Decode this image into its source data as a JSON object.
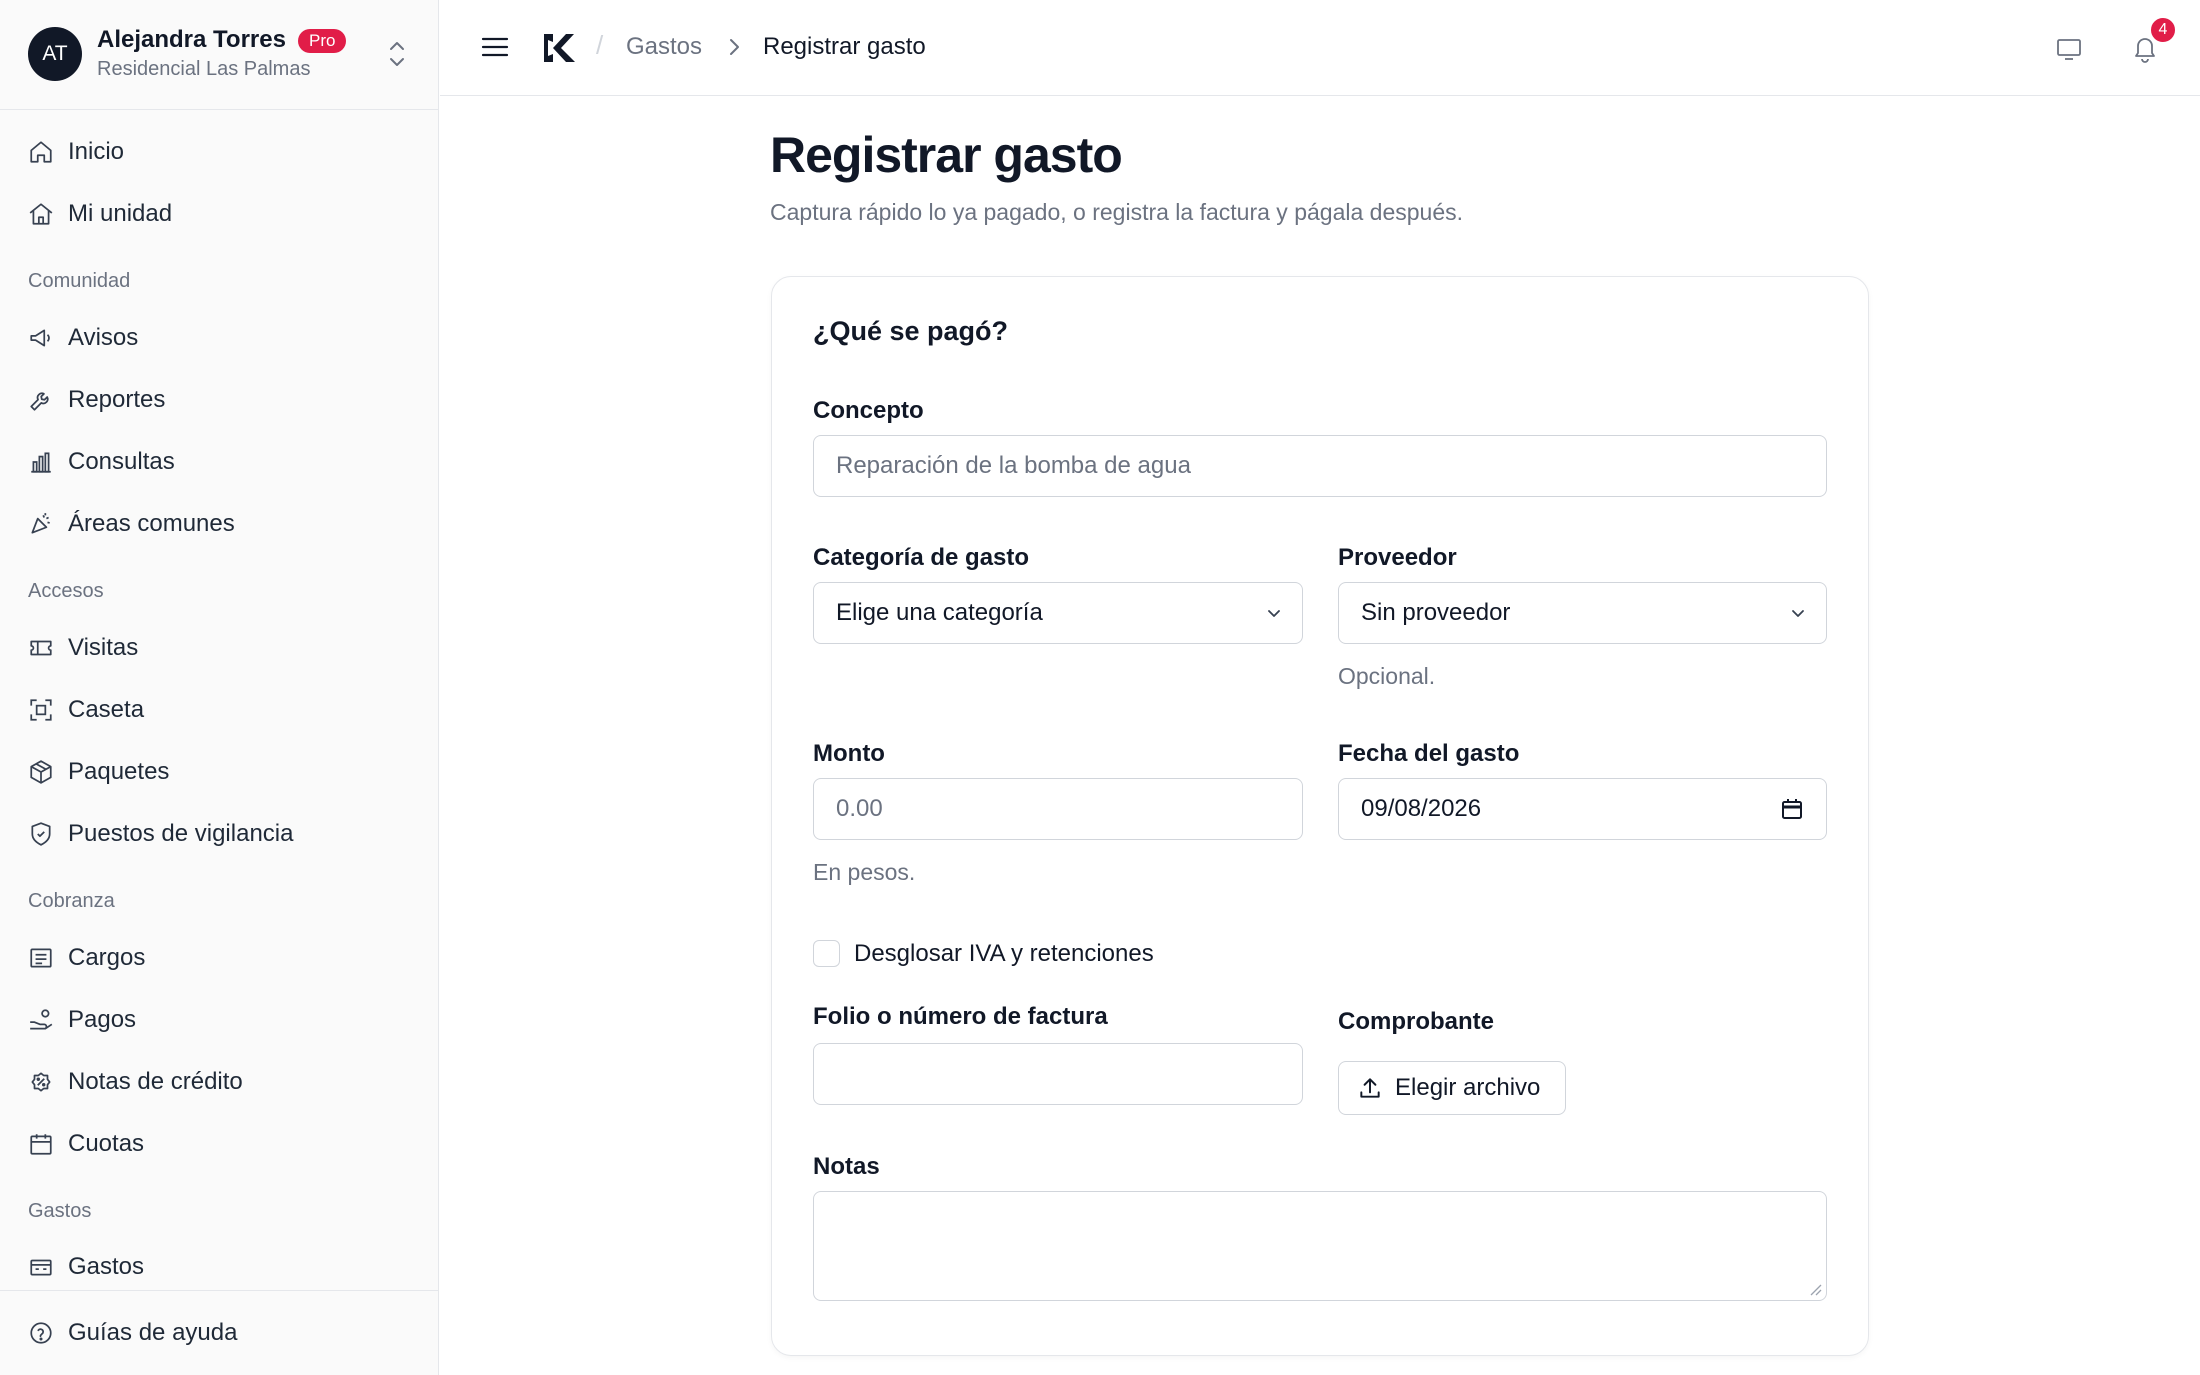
{
  "account": {
    "initials": "AT",
    "name": "Alejandra Torres",
    "plan_badge": "Pro",
    "community": "Residencial Las Palmas"
  },
  "sidebar": {
    "top_items": [
      {
        "label": "Inicio",
        "icon": "home-icon"
      },
      {
        "label": "Mi unidad",
        "icon": "house-icon"
      }
    ],
    "sections": [
      {
        "title": "Comunidad",
        "items": [
          {
            "label": "Avisos",
            "icon": "megaphone-icon"
          },
          {
            "label": "Reportes",
            "icon": "wrench-icon"
          },
          {
            "label": "Consultas",
            "icon": "bar-chart-icon"
          },
          {
            "label": "Áreas comunes",
            "icon": "party-popper-icon"
          }
        ]
      },
      {
        "title": "Accesos",
        "items": [
          {
            "label": "Visitas",
            "icon": "ticket-icon"
          },
          {
            "label": "Caseta",
            "icon": "scan-icon"
          },
          {
            "label": "Paquetes",
            "icon": "package-icon"
          },
          {
            "label": "Puestos de vigilancia",
            "icon": "shield-icon"
          }
        ]
      },
      {
        "title": "Cobranza",
        "items": [
          {
            "label": "Cargos",
            "icon": "receipt-icon"
          },
          {
            "label": "Pagos",
            "icon": "hand-coins-icon"
          },
          {
            "label": "Notas de crédito",
            "icon": "badge-percent-icon"
          },
          {
            "label": "Cuotas",
            "icon": "calendar-icon"
          }
        ]
      },
      {
        "title": "Gastos",
        "items": [
          {
            "label": "Gastos",
            "icon": "wallet-icon"
          }
        ]
      }
    ],
    "footer_item": {
      "label": "Guías de ayuda",
      "icon": "help-circle-icon"
    }
  },
  "topbar": {
    "breadcrumb": {
      "parent": "Gastos",
      "separator": "/",
      "current": "Registrar gasto"
    },
    "notifications_count": "4"
  },
  "page": {
    "title": "Registrar gasto",
    "subtitle": "Captura rápido lo ya pagado, o registra la factura y págala después."
  },
  "form": {
    "section_title": "¿Qué se pagó?",
    "concepto": {
      "label": "Concepto",
      "placeholder": "Reparación de la bomba de agua"
    },
    "categoria": {
      "label": "Categoría de gasto",
      "value": "Elige una categoría"
    },
    "proveedor": {
      "label": "Proveedor",
      "value": "Sin proveedor",
      "help": "Opcional."
    },
    "monto": {
      "label": "Monto",
      "placeholder": "0.00",
      "help": "En pesos."
    },
    "fecha": {
      "label": "Fecha del gasto",
      "value": "09/08/2026"
    },
    "desglosar": {
      "label": "Desglosar IVA y retenciones",
      "checked": false
    },
    "folio": {
      "label": "Folio o número de factura",
      "value": ""
    },
    "comprobante": {
      "label": "Comprobante",
      "button_label": "Elegir archivo"
    },
    "notas": {
      "label": "Notas",
      "value": ""
    }
  },
  "colors": {
    "accent": "#e11d48",
    "text_primary": "#111827",
    "text_muted": "#6b7280",
    "border": "#d1d5db",
    "sidebar_bg": "#fafafa"
  }
}
